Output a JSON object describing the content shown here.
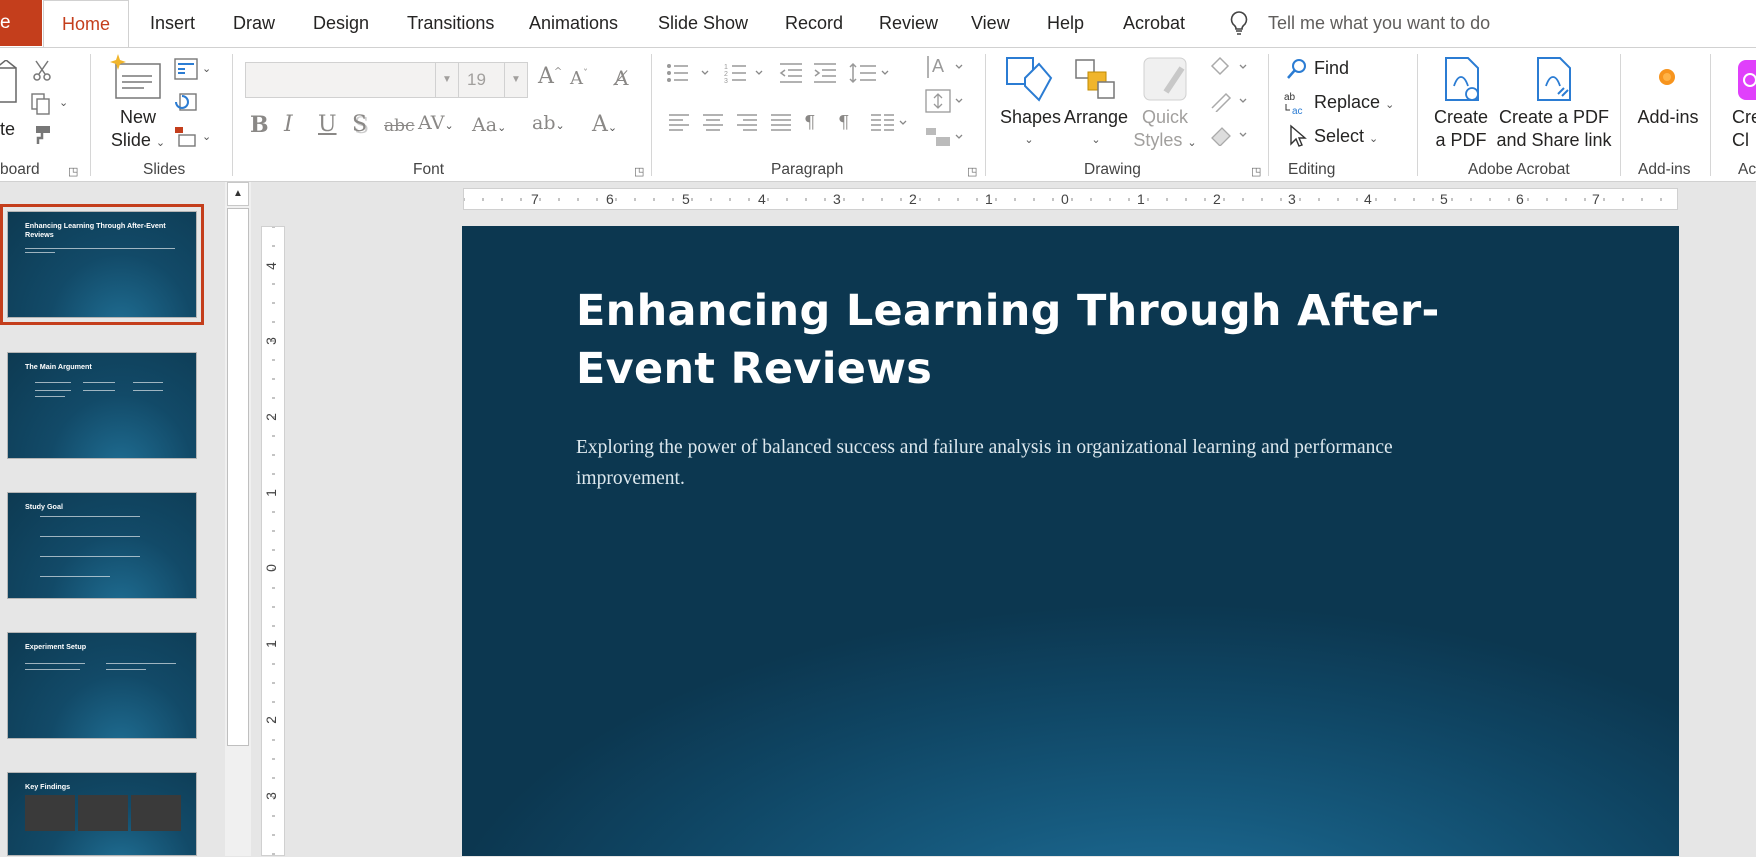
{
  "tabs": {
    "file": "e",
    "items": [
      "Home",
      "Insert",
      "Draw",
      "Design",
      "Transitions",
      "Animations",
      "Slide Show",
      "Record",
      "Review",
      "View",
      "Help",
      "Acrobat"
    ],
    "active": "Home",
    "tell_me": "Tell me what you want to do"
  },
  "ribbon": {
    "clipboard": {
      "paste_label": "te",
      "group_label": "board"
    },
    "slides": {
      "new_slide_line1": "New",
      "new_slide_line2": "Slide",
      "group_label": "Slides"
    },
    "font": {
      "font_name": "",
      "font_size": "19",
      "group_label": "Font"
    },
    "paragraph": {
      "group_label": "Paragraph"
    },
    "drawing": {
      "shapes": "Shapes",
      "arrange": "Arrange",
      "quick_styles_1": "Quick",
      "quick_styles_2": "Styles",
      "group_label": "Drawing"
    },
    "editing": {
      "find": "Find",
      "replace": "Replace",
      "select": "Select",
      "group_label": "Editing"
    },
    "acrobat": {
      "create_pdf_1": "Create",
      "create_pdf_2": "a PDF",
      "share_1": "Create a PDF",
      "share_2": "and Share link",
      "group_label": "Adobe Acrobat"
    },
    "addins": {
      "label": "Add-ins",
      "group_label": "Add-ins"
    },
    "cut_off": {
      "label1": "Cre",
      "label2": "Cl",
      "group_label": "Ac"
    }
  },
  "ruler": {
    "horizontal": [
      "7",
      "6",
      "5",
      "4",
      "3",
      "2",
      "1",
      "0",
      "1",
      "2",
      "3",
      "4",
      "5",
      "6",
      "7"
    ],
    "vertical": [
      "4",
      "3",
      "2",
      "1",
      "0",
      "1",
      "2",
      "3"
    ]
  },
  "thumbnails": [
    {
      "title": "Enhancing Learning Through After-Event Reviews",
      "selected": true
    },
    {
      "title": "The Main Argument",
      "selected": false
    },
    {
      "title": "Study Goal",
      "selected": false
    },
    {
      "title": "Experiment Setup",
      "selected": false
    },
    {
      "title": "Key Findings",
      "selected": false
    }
  ],
  "slide": {
    "title": "Enhancing Learning Through After-Event Reviews",
    "subtitle": "Exploring the power of balanced success and failure analysis in organizational learning and performance improvement."
  },
  "colors": {
    "accent": "#c43e1c",
    "slide_bg": "#0f4563",
    "icon_blue": "#2b7cd3"
  }
}
